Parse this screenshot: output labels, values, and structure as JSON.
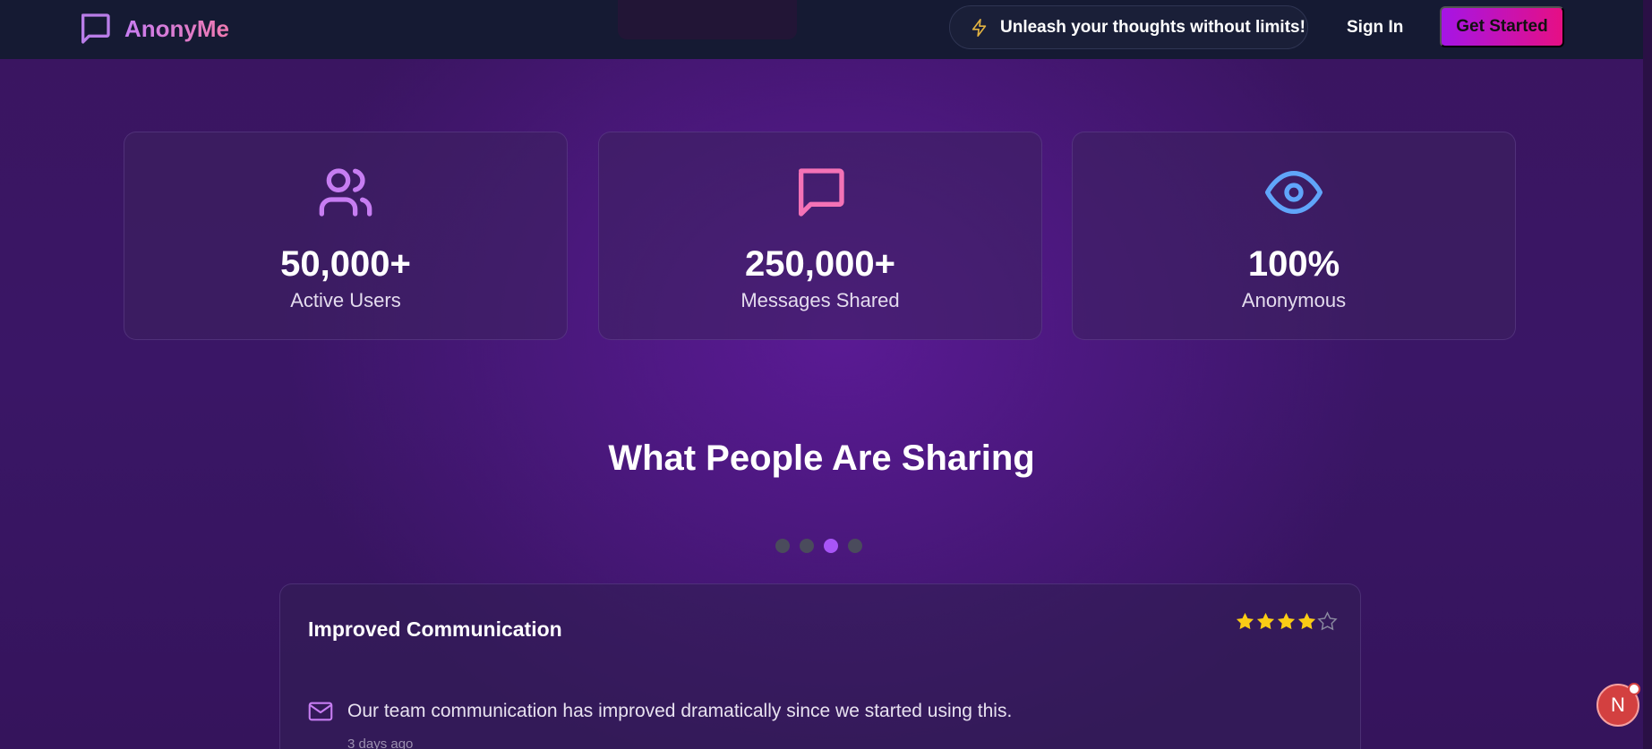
{
  "nav": {
    "brand": "AnonyMe",
    "tagline": "Unleash your thoughts without limits!",
    "sign_in": "Sign In",
    "get_started": "Get Started"
  },
  "stats": [
    {
      "icon": "users-icon",
      "value": "50,000+",
      "label": "Active Users",
      "color": "#c77df2"
    },
    {
      "icon": "message-square-icon",
      "value": "250,000+",
      "label": "Messages Shared",
      "color": "#f472b6"
    },
    {
      "icon": "eye-icon",
      "value": "100%",
      "label": "Anonymous",
      "color": "#60a5fa"
    }
  ],
  "section": {
    "title": "What People Are Sharing"
  },
  "carousel": {
    "count": 4,
    "active_index": 2
  },
  "testimonial": {
    "title": "Improved Communication",
    "rating": 4,
    "max_rating": 5,
    "message": "Our team communication has improved dramatically since we started using this.",
    "time": "3 days ago"
  },
  "float": {
    "initial": "N"
  },
  "colors": {
    "accent_purple": "#a855f7",
    "accent_pink": "#e60f84",
    "star": "#facc15",
    "nav_bg": "#151a33"
  }
}
